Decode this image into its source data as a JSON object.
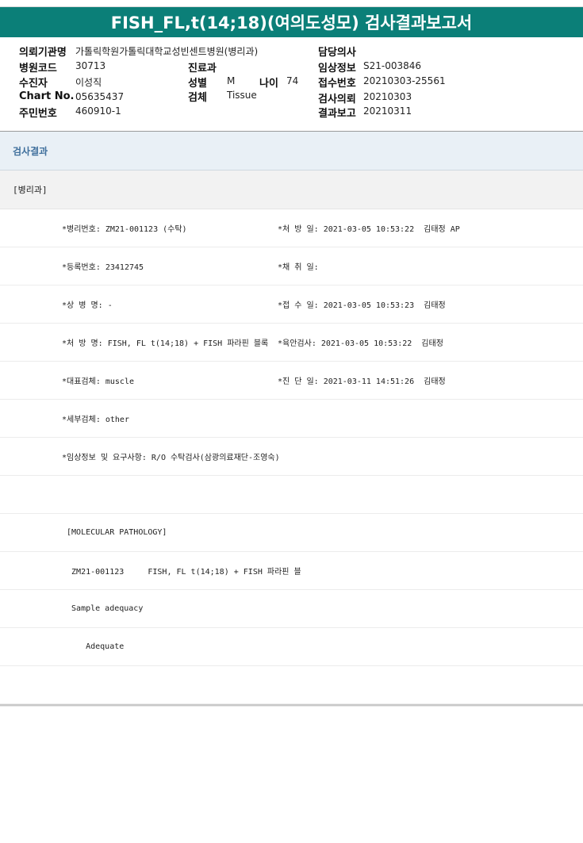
{
  "title": "FISH_FL,t(14;18)(여의도성모) 검사결과보고서",
  "info": {
    "institution_label": "의뢰기관명",
    "institution_value": "가톨릭학원가톨릭대학교성빈센트병원(병리과)",
    "doctor_label": "담당의사",
    "doctor_value": "",
    "hospital_code_label": "병원코드",
    "hospital_code_value": "30713",
    "department_label": "진료과",
    "department_value": "",
    "clinical_info_label": "임상정보",
    "clinical_info_value": "S21-003846",
    "patient_label": "수진자",
    "patient_value": "이성직",
    "sex_label": "성별",
    "sex_value": "M",
    "age_label": "나이",
    "age_value": "74",
    "receipt_no_label": "접수번호",
    "receipt_no_value": "20210303-25561",
    "chart_no_label": "Chart No.",
    "chart_no_value": "05635437",
    "specimen_label": "검체",
    "specimen_value": "Tissue",
    "request_label": "검사의뢰",
    "request_value": "20210303",
    "rrn_label": "주민번호",
    "rrn_value": "460910-1",
    "report_label": "결과보고",
    "report_value": "20210311"
  },
  "section_title": "검사결과",
  "department_header": "[병리과]",
  "rows": [
    {
      "left": "*병리번호: ZM21-001123 (수탁)",
      "right": "*처 방 일: 2021-03-05 10:53:22  김태정 AP"
    },
    {
      "left": "*등록번호: 23412745",
      "right": "*채 취 일:"
    },
    {
      "left": "*상 병 명: -",
      "right": "*접 수 일: 2021-03-05 10:53:23  김태정"
    },
    {
      "left": "*처 방 명: FISH, FL t(14;18) + FISH 파라핀 블록",
      "right": "*육안검사: 2021-03-05 10:53:22  김태정"
    },
    {
      "left": "*대표검체: muscle",
      "right": "*진 단 일: 2021-03-11 14:51:26  김태정"
    }
  ],
  "detail_rows": [
    "*세부검체: other",
    "*임상정보 및 요구사항: R/O 수탁검사(삼광의료재단-조영숙)",
    "",
    " [MOLECULAR PATHOLOGY]",
    "  ZM21-001123     FISH, FL t(14;18) + FISH 파라핀 블",
    "  Sample adequacy",
    "     Adequate",
    ""
  ]
}
